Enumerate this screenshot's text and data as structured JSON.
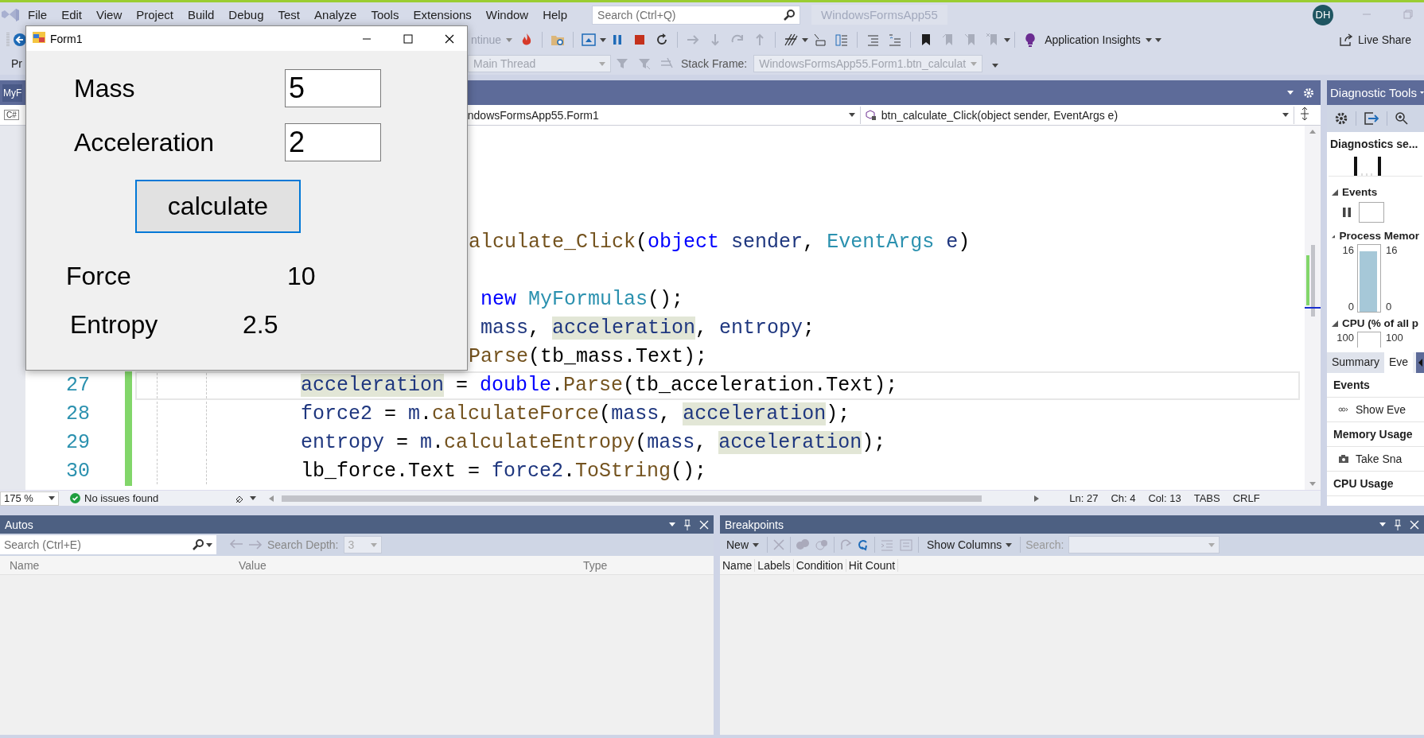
{
  "menu": {
    "items": [
      "File",
      "Edit",
      "View",
      "Project",
      "Build",
      "Debug",
      "Test",
      "Analyze",
      "Tools",
      "Extensions",
      "Window",
      "Help"
    ],
    "search": {
      "placeholder": "Search (Ctrl+Q)"
    },
    "solution_name": "WindowsFormsApp55",
    "avatar": "DH"
  },
  "toolbar": {
    "continue": "ntinue",
    "insights": "Application Insights",
    "live_share": "Live Share"
  },
  "debug_location": {
    "project": "Pr",
    "thread": "Main Thread",
    "stack_frame_label": "Stack Frame:",
    "stack_frame": "WindowsFormsApp55.Form1.btn_calculat"
  },
  "document_tab": {
    "label": "MyF"
  },
  "nav_bar": {
    "project_badge": "C#",
    "type": "ndowsFormsApp55.Form1",
    "member": "btn_calculate_Click(object sender, EventArgs e)"
  },
  "code": {
    "lines": [
      {
        "current": false,
        "tokens": [
          {
            "text": "alculate_Click",
            "kind": "method"
          },
          {
            "text": "(",
            "kind": "plain"
          },
          {
            "text": "object",
            "kind": "keyword"
          },
          {
            "text": " sender",
            "kind": "name"
          },
          {
            "text": ", ",
            "kind": "plain"
          },
          {
            "text": "EventArgs",
            "kind": "type"
          },
          {
            "text": " e",
            "kind": "name"
          },
          {
            "text": ")",
            "kind": "plain"
          }
        ]
      },
      {
        "current": false,
        "tokens": [
          {
            "text": "new",
            "kind": "keyword"
          },
          {
            "text": " MyFormulas",
            "kind": "type"
          },
          {
            "text": "();",
            "kind": "plain"
          }
        ]
      },
      {
        "current": false,
        "tokens": [
          {
            "text": "mass",
            "kind": "name"
          },
          {
            "text": ", ",
            "kind": "plain"
          },
          {
            "text": "acceleration",
            "kind": "ref"
          },
          {
            "text": ", ",
            "kind": "plain"
          },
          {
            "text": "entropy",
            "kind": "name"
          },
          {
            "text": ";",
            "kind": "plain"
          }
        ]
      },
      {
        "current": false,
        "tokens": [
          {
            "text": "Parse",
            "kind": "method"
          },
          {
            "text": "(tb_mass.Text);",
            "kind": "plain"
          }
        ]
      },
      {
        "number": "27",
        "current": true,
        "changed": true,
        "tokens": [
          {
            "text": "acceleration",
            "kind": "ref"
          },
          {
            "text": " = ",
            "kind": "plain"
          },
          {
            "text": "double",
            "kind": "keyword"
          },
          {
            "text": ".",
            "kind": "plain"
          },
          {
            "text": "Parse",
            "kind": "method"
          },
          {
            "text": "(tb_acceleration.Text);",
            "kind": "plain"
          }
        ]
      },
      {
        "number": "28",
        "current": false,
        "changed": true,
        "tokens": [
          {
            "text": "force2",
            "kind": "name"
          },
          {
            "text": " = ",
            "kind": "plain"
          },
          {
            "text": "m",
            "kind": "name"
          },
          {
            "text": ".",
            "kind": "plain"
          },
          {
            "text": "calculateForce",
            "kind": "method"
          },
          {
            "text": "(",
            "kind": "plain"
          },
          {
            "text": "mass",
            "kind": "name"
          },
          {
            "text": ", ",
            "kind": "plain"
          },
          {
            "text": "acceleration",
            "kind": "ref"
          },
          {
            "text": ");",
            "kind": "plain"
          }
        ]
      },
      {
        "number": "29",
        "current": false,
        "changed": true,
        "tokens": [
          {
            "text": "entropy",
            "kind": "name"
          },
          {
            "text": " = ",
            "kind": "plain"
          },
          {
            "text": "m",
            "kind": "name"
          },
          {
            "text": ".",
            "kind": "plain"
          },
          {
            "text": "calculateEntropy",
            "kind": "method"
          },
          {
            "text": "(",
            "kind": "plain"
          },
          {
            "text": "mass",
            "kind": "name"
          },
          {
            "text": ", ",
            "kind": "plain"
          },
          {
            "text": "acceleration",
            "kind": "ref"
          },
          {
            "text": ");",
            "kind": "plain"
          }
        ]
      },
      {
        "number": "30",
        "current": false,
        "changed": true,
        "tokens": [
          {
            "text": "lb_force.Text = ",
            "kind": "plain"
          },
          {
            "text": "force2",
            "kind": "name"
          },
          {
            "text": ".",
            "kind": "plain"
          },
          {
            "text": "ToString",
            "kind": "method"
          },
          {
            "text": "();",
            "kind": "plain"
          }
        ]
      }
    ]
  },
  "status_bar": {
    "zoom": "175 %",
    "issues": "No issues found",
    "line": "Ln: 27",
    "char": "Ch: 4",
    "column": "Col: 13",
    "indent": "TABS",
    "line_ending": "CRLF"
  },
  "diagnostic_tools": {
    "title": "Diagnostic Tools",
    "session": "Diagnostics se...",
    "events": {
      "title": "Events",
      "expanded": true
    },
    "memory": {
      "title": "Process Memor",
      "expanded": true,
      "left_max": "16",
      "left_min": "0",
      "right_max": "16",
      "right_min": "0"
    },
    "cpu": {
      "title": "CPU (% of all p",
      "expanded": true,
      "left_max": "100",
      "right_max": "100"
    },
    "tabs": [
      {
        "label": "Summary",
        "selected": true
      },
      {
        "label": "Eve",
        "selected": false
      }
    ],
    "summary": [
      {
        "heading": "Events",
        "action": "Show Eve",
        "kind": "events"
      },
      {
        "heading": "Memory Usage",
        "action": "Take Sna",
        "kind": "snapshot"
      },
      {
        "heading": "CPU Usage"
      }
    ]
  },
  "autos": {
    "title": "Autos",
    "search": {
      "placeholder": "Search (Ctrl+E)"
    },
    "search_depth_label": "Search Depth:",
    "search_depth": "3",
    "columns": [
      "Name",
      "Value",
      "Type"
    ]
  },
  "breakpoints": {
    "title": "Breakpoints",
    "new": "New",
    "show_columns": "Show Columns",
    "search_label": "Search:",
    "columns": [
      "Name",
      "Labels",
      "Condition",
      "Hit Count"
    ]
  },
  "form1": {
    "title": "Form1",
    "fields": [
      {
        "label": "Mass",
        "value": "5"
      },
      {
        "label": "Acceleration",
        "value": "2"
      }
    ],
    "button": "calculate",
    "results": [
      {
        "label": "Force",
        "value": "10"
      },
      {
        "label": "Entropy",
        "value": "2.5"
      }
    ]
  }
}
